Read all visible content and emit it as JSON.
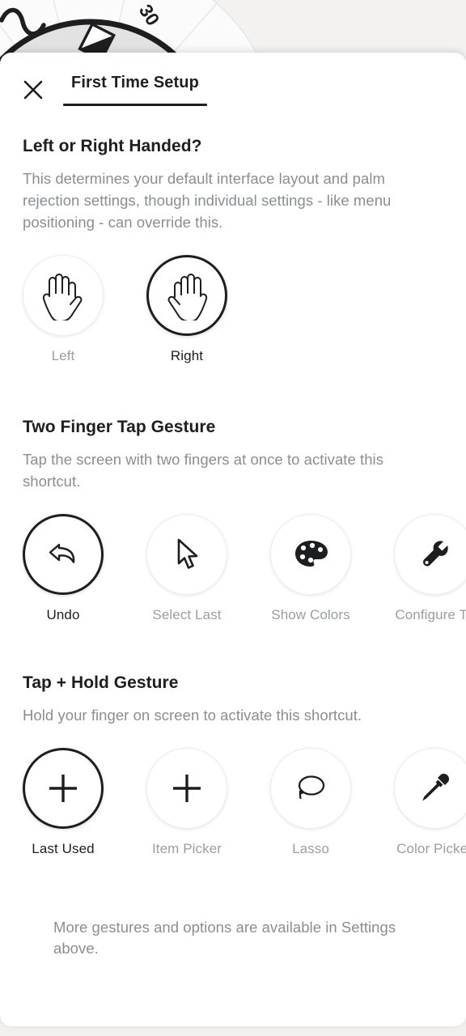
{
  "background": {
    "name": "radial-tool-wheel",
    "dial_label": "30",
    "colors": {
      "canvas": "#f3f2f1",
      "wheel_fill": "#e2e2e2",
      "wheel_stroke": "#1d1e20"
    }
  },
  "header": {
    "close_icon": "close-icon",
    "title": "First Time Setup"
  },
  "sections": [
    {
      "key": "handedness",
      "title": "Left or Right Handed?",
      "description": "This determines your default interface layout and palm rejection settings, though individual settings - like menu positioning - can override this.",
      "options": [
        {
          "label": "Left",
          "icon": "left-hand-icon",
          "selected": false
        },
        {
          "label": "Right",
          "icon": "right-hand-icon",
          "selected": true
        }
      ]
    },
    {
      "key": "two_finger_tap",
      "title": "Two Finger Tap Gesture",
      "description": "Tap the screen with two fingers at once to activate this shortcut.",
      "options": [
        {
          "label": "Undo",
          "icon": "undo-arrow-icon",
          "selected": true
        },
        {
          "label": "Select Last",
          "icon": "cursor-arrow-icon",
          "selected": false
        },
        {
          "label": "Show Colors",
          "icon": "palette-icon",
          "selected": false
        },
        {
          "label": "Configure To",
          "icon": "wrench-icon",
          "selected": false
        }
      ]
    },
    {
      "key": "tap_hold",
      "title": "Tap + Hold Gesture",
      "description": "Hold your finger on screen to activate this shortcut.",
      "options": [
        {
          "label": "Last Used",
          "icon": "plus-icon",
          "selected": true
        },
        {
          "label": "Item Picker",
          "icon": "plus-icon",
          "selected": false
        },
        {
          "label": "Lasso",
          "icon": "lasso-icon",
          "selected": false
        },
        {
          "label": "Color Picker",
          "icon": "eyedropper-icon",
          "selected": false
        }
      ]
    }
  ],
  "footer": {
    "note": "More gestures and options are available in Settings above."
  },
  "colors": {
    "text_primary": "#1d1e20",
    "text_muted": "#8b8e91",
    "accent": "#1d1e20",
    "sheet_bg": "#ffffff"
  }
}
